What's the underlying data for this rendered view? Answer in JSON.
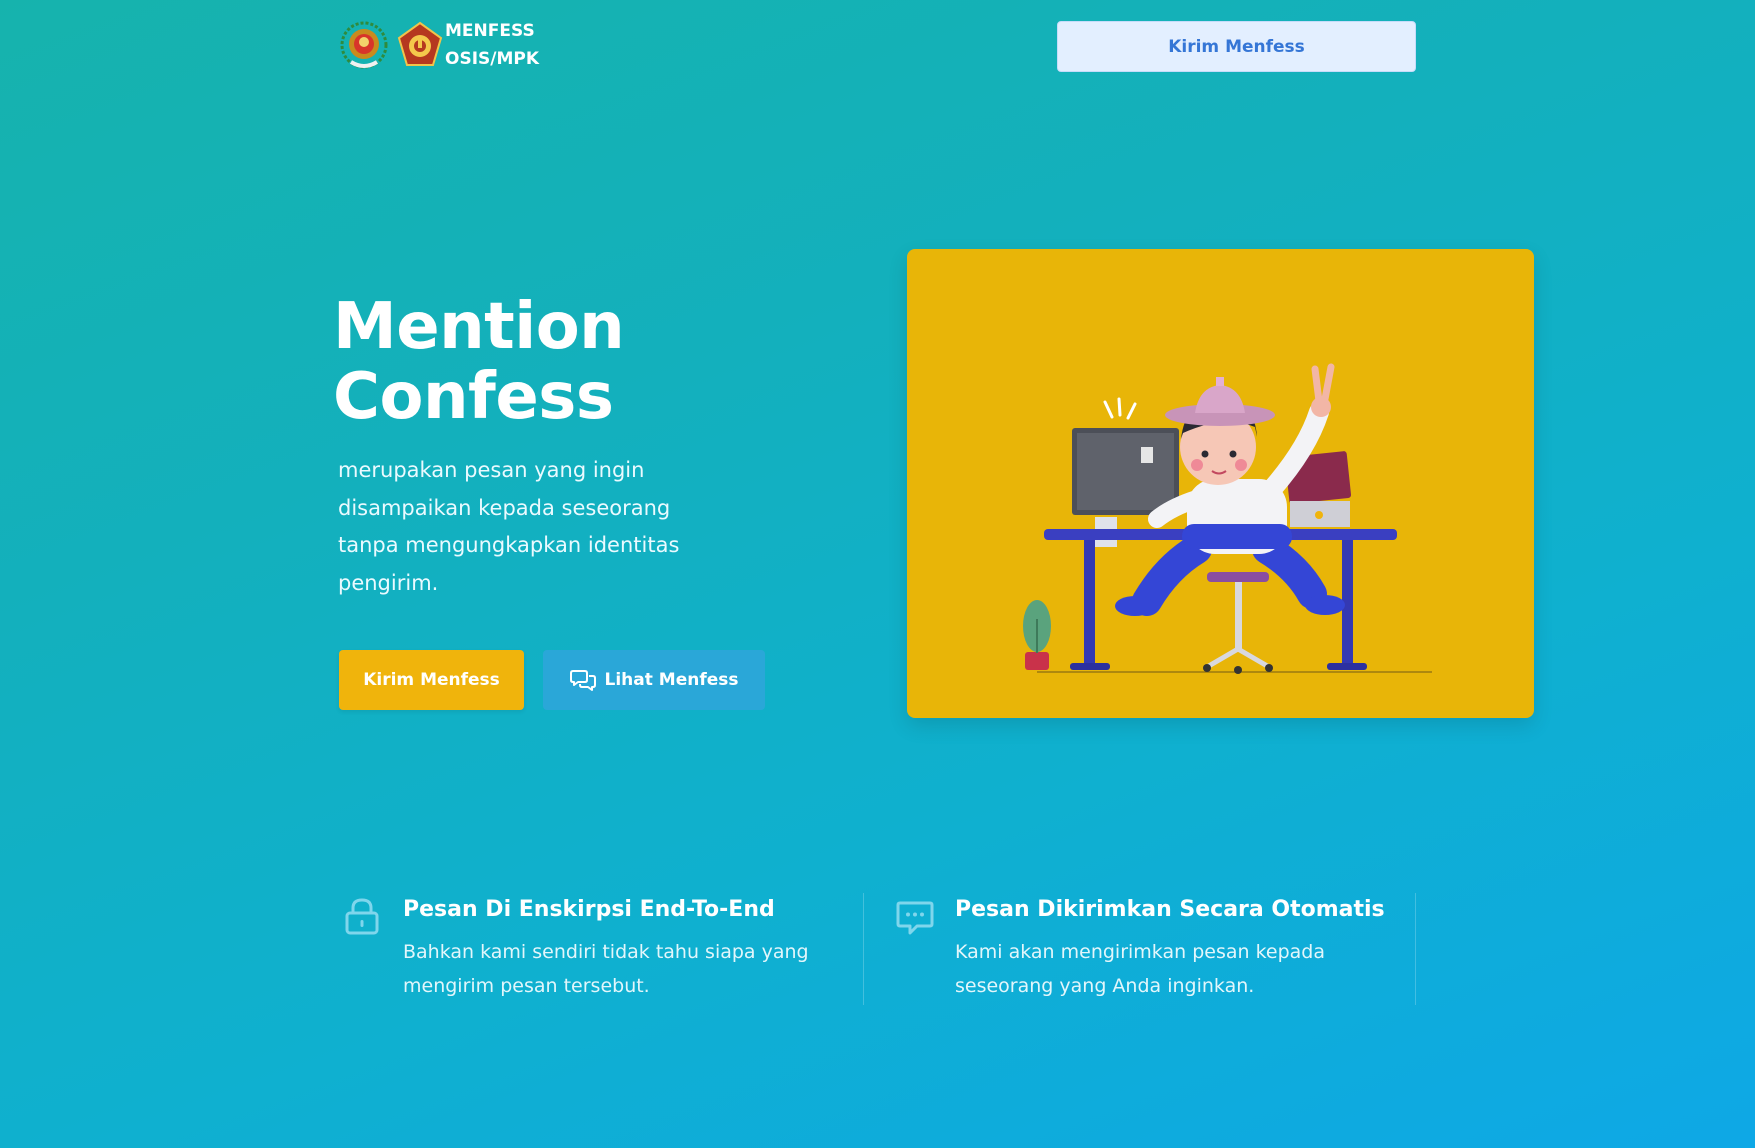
{
  "header": {
    "brand_line1": "MENFESS",
    "brand_line2": "OSIS/MPK",
    "nav_button_label": "Kirim Menfess"
  },
  "hero": {
    "title_line1": "Mention",
    "title_line2": "Confess",
    "description_lines": [
      "merupakan pesan yang ingin",
      "disampaikan kepada seseorang",
      "tanpa mengungkapkan identitas",
      "pengirim."
    ],
    "primary_button_label": "Kirim Menfess",
    "secondary_button_label": "Lihat Menfess",
    "secondary_button_icon": "chat-bubbles-icon",
    "illustration": "person-at-desk-illustration"
  },
  "features": [
    {
      "icon": "lock-icon",
      "title": "Pesan Di Enskirpsi End-To-End",
      "description_lines": [
        "Bahkan kami sendiri tidak tahu siapa yang",
        "mengirim pesan tersebut."
      ]
    },
    {
      "icon": "message-dots-icon",
      "title": "Pesan Dikirimkan Secara Otomatis",
      "description_lines": [
        "Kami akan mengirimkan pesan kepada",
        "seseorang yang Anda inginkan."
      ]
    }
  ],
  "colors": {
    "background_start": "#16b3ad",
    "background_end": "#0ea8e6",
    "primary_button": "#f0b40c",
    "secondary_button": "#2aa7d8",
    "nav_button_bg": "#e3efff",
    "nav_button_text": "#3576d6",
    "illustration_bg": "#e8b508"
  }
}
